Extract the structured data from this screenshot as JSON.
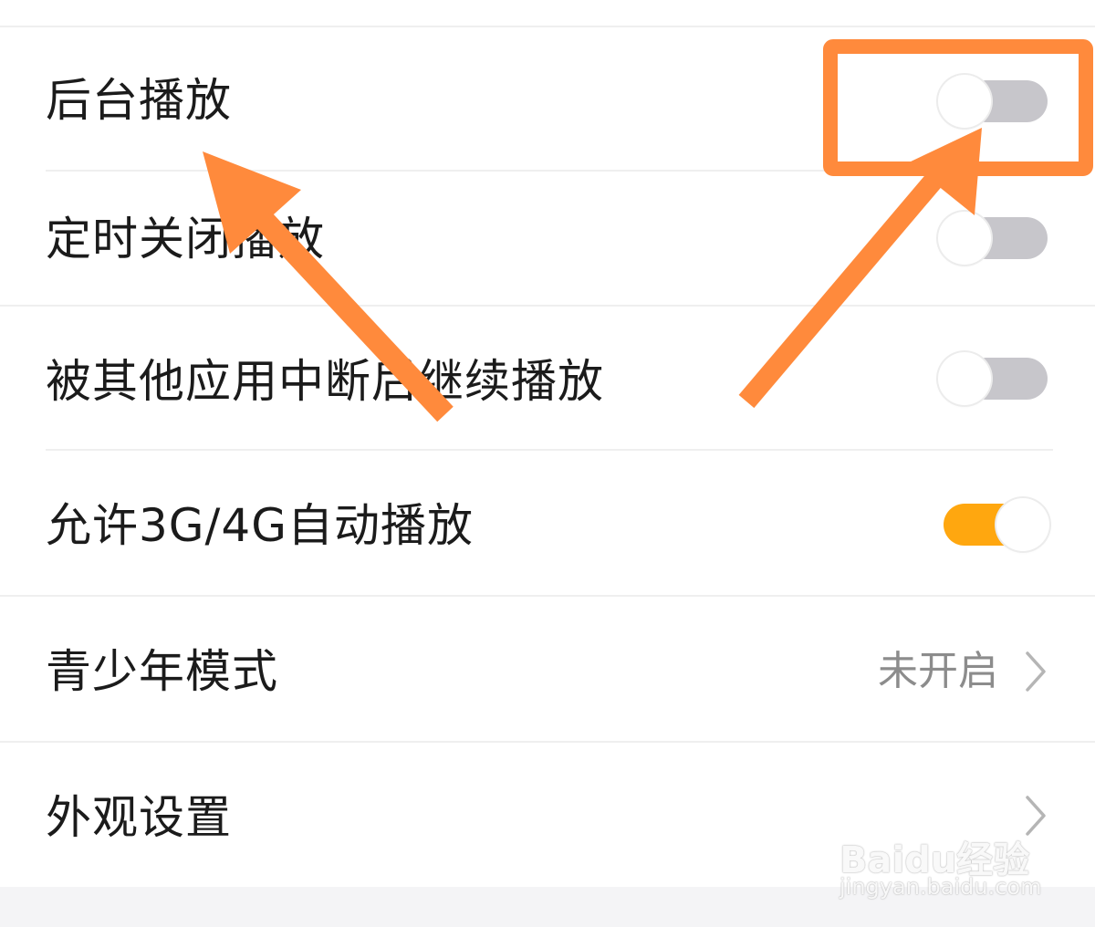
{
  "settings": [
    {
      "label": "后台播放",
      "type": "toggle",
      "on": false
    },
    {
      "label": "定时关闭播放",
      "type": "toggle",
      "on": false
    },
    {
      "label": "被其他应用中断后继续播放",
      "type": "toggle",
      "on": false
    },
    {
      "label": "允许3G/4G自动播放",
      "type": "toggle",
      "on": true
    },
    {
      "label": "青少年模式",
      "type": "link",
      "value": "未开启"
    },
    {
      "label": "外观设置",
      "type": "link",
      "value": ""
    }
  ],
  "colors": {
    "toggle_on": "#ffa70f",
    "toggle_off": "#c7c6cb",
    "annotation": "#ff8a3c"
  },
  "watermark": {
    "brand": "Baidu经验",
    "url": "jingyan.baidu.com"
  }
}
